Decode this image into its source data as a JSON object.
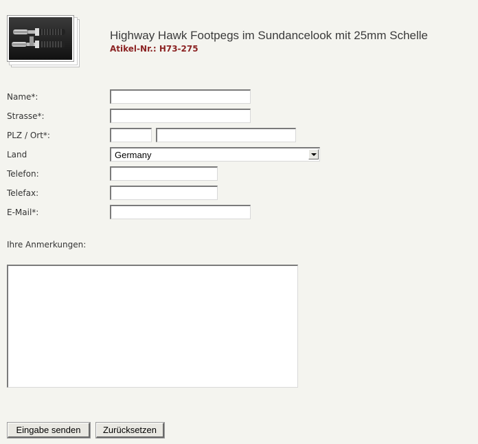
{
  "product": {
    "title": "Highway Hawk Footpegs im Sundancelook mit 25mm Schelle",
    "article_number": "Atikel-Nr.: H73-275",
    "article_color": "#8b2323"
  },
  "form": {
    "name": {
      "label": "Name*:",
      "value": ""
    },
    "street": {
      "label": "Strasse*:",
      "value": ""
    },
    "zip_city": {
      "label": "PLZ / Ort*:",
      "zip_value": "",
      "city_value": ""
    },
    "country": {
      "label": "Land",
      "selected": "Germany"
    },
    "phone": {
      "label": "Telefon:",
      "value": ""
    },
    "fax": {
      "label": "Telefax:",
      "value": ""
    },
    "email": {
      "label": "E-Mail*:",
      "value": ""
    },
    "remarks": {
      "label": "Ihre Anmerkungen:",
      "value": ""
    }
  },
  "buttons": {
    "submit_label": "Eingabe senden",
    "reset_label": "Zurücksetzen"
  }
}
